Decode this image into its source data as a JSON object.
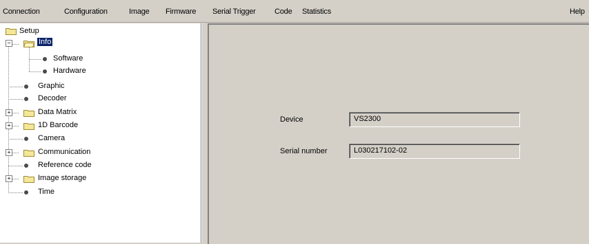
{
  "menubar": {
    "items": [
      "Connection",
      "Configuration",
      "Image",
      "Firmware",
      "Serial Trigger",
      "Code",
      "Statistics"
    ],
    "help": "Help"
  },
  "tree": {
    "root": "Setup",
    "items": [
      {
        "label": "Info",
        "type": "folder",
        "selected": true
      },
      {
        "label": "Software",
        "type": "leaf"
      },
      {
        "label": "Hardware",
        "type": "leaf"
      },
      {
        "label": "Graphic",
        "type": "leaf"
      },
      {
        "label": "Decoder",
        "type": "leaf"
      },
      {
        "label": "Data Matrix",
        "type": "folder"
      },
      {
        "label": "1D Barcode",
        "type": "folder"
      },
      {
        "label": "Camera",
        "type": "leaf"
      },
      {
        "label": "Communication",
        "type": "folder"
      },
      {
        "label": "Reference code",
        "type": "leaf"
      },
      {
        "label": "Image storage",
        "type": "folder"
      },
      {
        "label": "Time",
        "type": "leaf"
      }
    ]
  },
  "info": {
    "device_label": "Device",
    "device_value": "VS2300",
    "serial_label": "Serial number",
    "serial_value": "L030217102-02"
  }
}
